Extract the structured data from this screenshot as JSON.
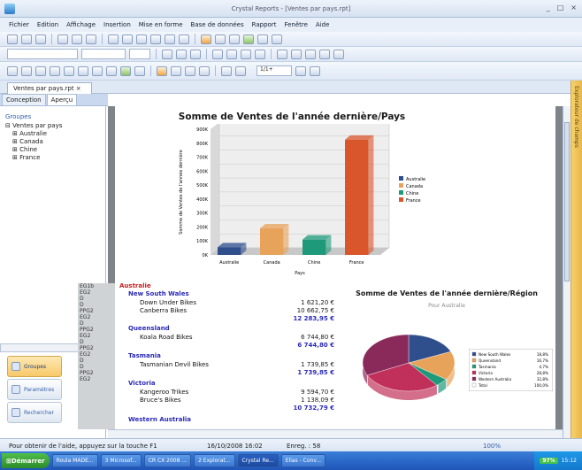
{
  "window": {
    "title": "Crystal Reports - [Ventes par pays.rpt]",
    "controls": [
      "_",
      "□",
      "×"
    ]
  },
  "menu": [
    "Fichier",
    "Edition",
    "Affichage",
    "Insertion",
    "Mise en forme",
    "Base de données",
    "Rapport",
    "Fenêtre",
    "Aide"
  ],
  "toolbar": {
    "page_indicator": "1/1+"
  },
  "doc_tab": "Ventes par pays.rpt",
  "view_tabs": [
    "Conception",
    "Aperçu"
  ],
  "left_panel": {
    "groups_title": "Groupes",
    "tree_root": "Ventes par pays",
    "tree_items": [
      "Australie",
      "Canada",
      "Chine",
      "France"
    ],
    "buttons": [
      "Groupes",
      "Paramètres",
      "Rechercher"
    ]
  },
  "right_strip": "Explorateur de champs",
  "chart_data": [
    {
      "type": "bar",
      "title": "Somme de Ventes de l'année dernière/Pays",
      "xlabel": "Pays",
      "ylabel": "Somme de Ventes de l'année dernière",
      "categories": [
        "Australie",
        "Canada",
        "Chine",
        "France"
      ],
      "values": [
        55000,
        190000,
        110000,
        825000
      ],
      "colors": [
        "#2e4e8c",
        "#e8a35a",
        "#1e9a7a",
        "#d9552a"
      ],
      "ylim": [
        0,
        900000
      ],
      "yticks": [
        "0K",
        "100K",
        "200K",
        "300K",
        "400K",
        "500K",
        "600K",
        "700K",
        "800K",
        "900K"
      ],
      "legend": [
        "Australie",
        "Canada",
        "Chine",
        "France"
      ],
      "legend_position": "right"
    },
    {
      "type": "pie",
      "title": "Somme de Ventes de l'année dernière/Région",
      "subtitle": "Pour Australie",
      "categories": [
        "New South Wales",
        "Queensland",
        "Tasmania",
        "Victoria",
        "Western Australia"
      ],
      "percent": [
        "18,8%",
        "16,7%",
        "4,7%",
        "28,8%",
        "32,8%"
      ],
      "values": [
        18.8,
        16.7,
        4.7,
        28.8,
        32.8
      ],
      "colors": [
        "#2e4e8c",
        "#e8a35a",
        "#1e9a7a",
        "#c0305a",
        "#8a2a5a"
      ],
      "legend": [
        "New South Wales",
        "Queensland",
        "Tasmania",
        "Victoria",
        "Western Australia",
        "Total"
      ],
      "legend_pct": [
        "18,8%",
        "16,7%",
        "4,7%",
        "28,8%",
        "32,8%",
        "100,0%"
      ],
      "legend_position": "right"
    }
  ],
  "report": {
    "group_column": [
      "EG1b",
      "EG2",
      "D",
      "D",
      "PPG2",
      "EG2",
      "D",
      "PPG2",
      "EG2",
      "D",
      "PPG2",
      "EG2",
      "D",
      "D",
      "PPG2",
      "EG2"
    ],
    "section": "Australie",
    "regions": [
      {
        "name": "New South Wales",
        "rows": [
          [
            "Down Under Bikes",
            "1 621,20 €"
          ],
          [
            "Canberra Bikes",
            "10 662,75 €"
          ]
        ],
        "subtotal": "12 283,95 €"
      },
      {
        "name": "Queensland",
        "rows": [
          [
            "Koala Road Bikes",
            "6 744,80 €"
          ]
        ],
        "subtotal": "6 744,80 €"
      },
      {
        "name": "Tasmania",
        "rows": [
          [
            "Tasmanian Devil Bikes",
            "1 739,85 €"
          ]
        ],
        "subtotal": "1 739,85 €"
      },
      {
        "name": "Victoria",
        "rows": [
          [
            "Kangeroo Trikes",
            "9 594,70 €"
          ],
          [
            "Bruce's Bikes",
            "1 138,09 €"
          ]
        ],
        "subtotal": "10 732,79 €"
      },
      {
        "name": "Western Australia",
        "rows": [],
        "subtotal": ""
      }
    ]
  },
  "status": {
    "hint": "Pour obtenir de l'aide, appuyez sur la touche F1",
    "date": "16/10/2008 16:02",
    "records": "Enreg. : 58",
    "zoom": "100%"
  },
  "taskbar": {
    "start": "Démarrer",
    "buttons": [
      "Roula MADE...",
      "3 Microsof...",
      "CR CX 2008 ...",
      "2 Explorat...",
      "Crystal Re...",
      "Elias - Conv..."
    ],
    "tray_pct": "97%",
    "clock": "15:12"
  }
}
